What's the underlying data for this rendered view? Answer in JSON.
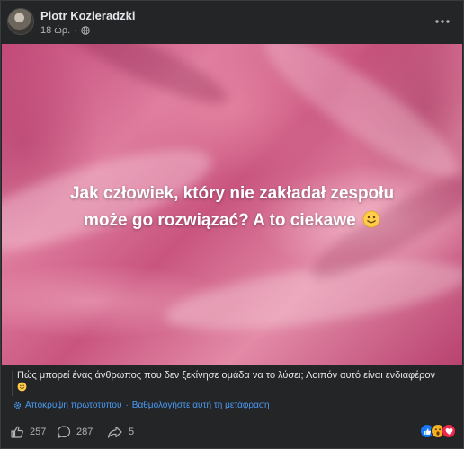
{
  "post": {
    "author": "Piotr Kozieradzki",
    "time": "18 ώρ.",
    "dot": "·",
    "more_icon": "more-horizontal-icon",
    "privacy_icon": "globe-icon"
  },
  "image": {
    "line1": "Jak człowiek, który nie zakładał zespołu",
    "line2": "może go rozwiązać? A to ciekawe",
    "emoji": "slightly-smiling-face-icon"
  },
  "translation": {
    "text": "Πώς μπορεί ένας άνθρωπος που δεν ξεκίνησε ομάδα να το λύσει; Λοιπόν αυτό είναι ενδιαφέρον",
    "hide_original": "Απόκρυψη πρωτοτύπου",
    "separator": "·",
    "rate": "Βαθμολογήστε αυτή τη μετάφραση",
    "link_color": "#4b9bf5"
  },
  "footer": {
    "likes": "257",
    "comments": "287",
    "shares": "5"
  },
  "colors": {
    "background": "#242526",
    "text": "#e4e6eb",
    "secondary": "#b0b3b8",
    "like_blue": "#1877f2"
  }
}
